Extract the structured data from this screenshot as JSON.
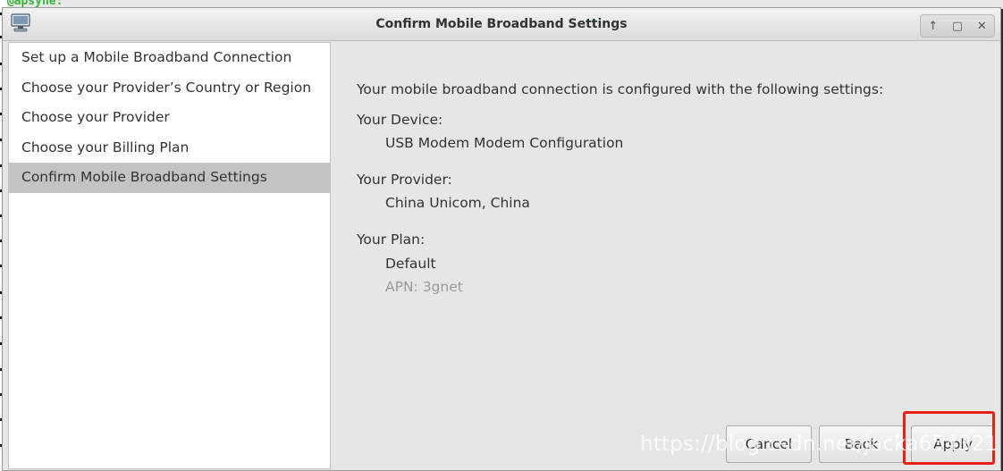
{
  "background": {
    "terminal_prompt": "c@apsyne:"
  },
  "window": {
    "title": "Confirm Mobile Broadband Settings",
    "controls": [
      "↑",
      "▢",
      "✕"
    ]
  },
  "sidebar": {
    "steps": [
      "Set up a Mobile Broadband Connection",
      "Choose your Provider’s Country or Region",
      "Choose your Provider",
      "Choose your Billing Plan",
      "Confirm Mobile Broadband Settings"
    ],
    "active_index": 4
  },
  "main": {
    "intro": "Your mobile broadband connection is configured with the following settings:",
    "device_label": "Your Device:",
    "device_value": "USB Modem Modem Configuration",
    "provider_label": "Your Provider:",
    "provider_value": "China Unicom, China",
    "plan_label": "Your Plan:",
    "plan_value": "Default",
    "apn": "APN: 3gnet"
  },
  "buttons": {
    "cancel": "Cancel",
    "back": "Back",
    "apply": "Apply"
  },
  "watermark": "https://blog.csdn.net/jacka654321",
  "colors": {
    "highlight": "#e8201a",
    "active_step": "#c3c3c3"
  }
}
